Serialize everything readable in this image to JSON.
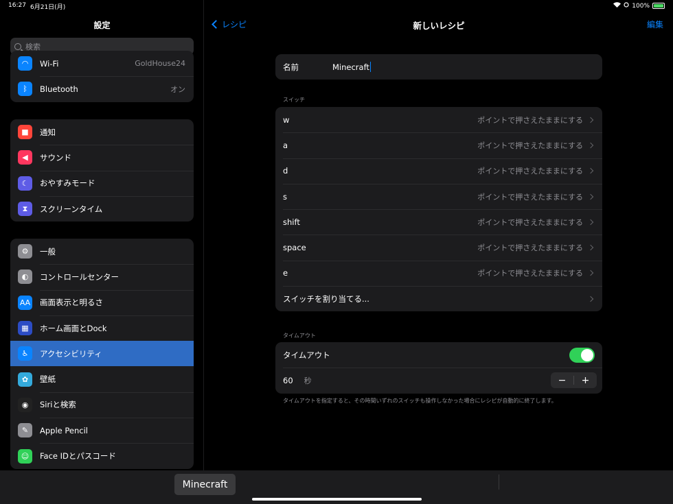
{
  "status": {
    "time": "16:27",
    "date": "6月21日(月)",
    "battery": "100%"
  },
  "sidebar": {
    "title": "設定",
    "search_placeholder": "検索",
    "group1": [
      {
        "label": "Wi-Fi",
        "value": "GoldHouse24",
        "icon": "wifi-icon",
        "color": "#0a84ff"
      },
      {
        "label": "Bluetooth",
        "value": "オン",
        "icon": "bluetooth-icon",
        "color": "#0a84ff"
      }
    ],
    "group2": [
      {
        "label": "通知",
        "icon": "notification-icon",
        "color": "#ff453a"
      },
      {
        "label": "サウンド",
        "icon": "sound-icon",
        "color": "#ff375f"
      },
      {
        "label": "おやすみモード",
        "icon": "moon-icon",
        "color": "#5e5ce6"
      },
      {
        "label": "スクリーンタイム",
        "icon": "hourglass-icon",
        "color": "#5e5ce6"
      }
    ],
    "group3": [
      {
        "label": "一般",
        "icon": "gear-icon",
        "color": "#8e8e93"
      },
      {
        "label": "コントロールセンター",
        "icon": "toggle-icon",
        "color": "#8e8e93"
      },
      {
        "label": "画面表示と明るさ",
        "icon": "display-icon",
        "color": "#0a84ff"
      },
      {
        "label": "ホーム画面とDock",
        "icon": "home-grid-icon",
        "color": "#2c4cc4"
      },
      {
        "label": "アクセシビリティ",
        "icon": "accessibility-icon",
        "color": "#0a84ff",
        "selected": true
      },
      {
        "label": "壁紙",
        "icon": "wallpaper-icon",
        "color": "#34aadc"
      },
      {
        "label": "Siriと検索",
        "icon": "siri-icon",
        "color": "#222"
      },
      {
        "label": "Apple Pencil",
        "icon": "pencil-icon",
        "color": "#8e8e93"
      },
      {
        "label": "Face IDとパスコード",
        "icon": "faceid-icon",
        "color": "#30d158"
      }
    ]
  },
  "detail": {
    "back_label": "レシピ",
    "title": "新しいレシピ",
    "edit_label": "編集",
    "name_label": "名前",
    "name_value": "Minecraft",
    "switch_header": "スイッチ",
    "switches": [
      {
        "key": "w",
        "action": "ポイントで押さえたままにする"
      },
      {
        "key": "a",
        "action": "ポイントで押さえたままにする"
      },
      {
        "key": "d",
        "action": "ポイントで押さえたままにする"
      },
      {
        "key": "s",
        "action": "ポイントで押さえたままにする"
      },
      {
        "key": "shift",
        "action": "ポイントで押さえたままにする"
      },
      {
        "key": "space",
        "action": "ポイントで押さえたままにする"
      },
      {
        "key": "e",
        "action": "ポイントで押さえたままにする"
      }
    ],
    "assign_label": "スイッチを割り当てる...",
    "timeout_header": "タイムアウト",
    "timeout_label": "タイムアウト",
    "timeout_value": "60",
    "timeout_unit": "秒",
    "stepper_minus": "−",
    "stepper_plus": "+",
    "footnote": "タイムアウトを指定すると、その時間いずれのスイッチも操作しなかった場合にレシピが自動的に終了します。"
  },
  "keyboard": {
    "suggestion": "Minecraft"
  },
  "colors": {
    "accent": "#0a84ff",
    "toggle_on": "#30d158",
    "selected_row": "#2f6cc4"
  }
}
